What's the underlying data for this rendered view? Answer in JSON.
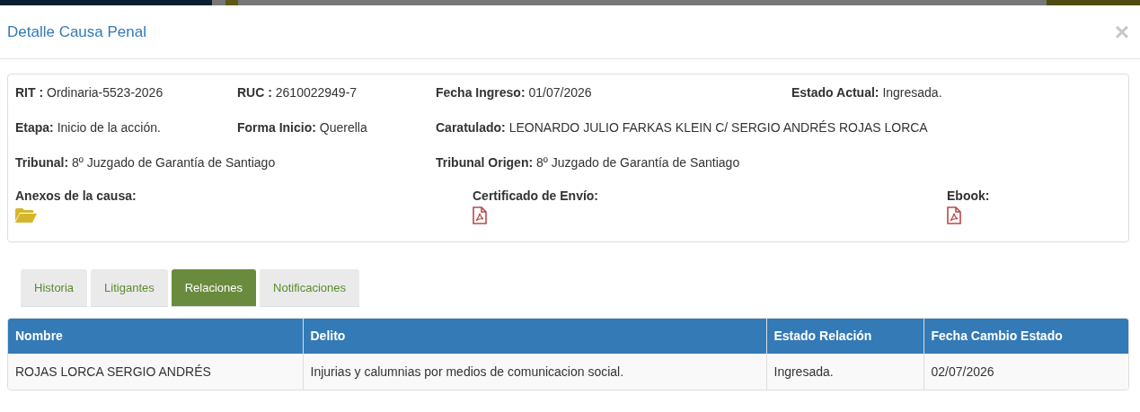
{
  "modal": {
    "title": "Detalle Causa Penal",
    "close": "×"
  },
  "fields": [
    [
      {
        "label": "RIT :",
        "value": "Ordinaria-5523-2026"
      },
      {
        "label": "RUC :",
        "value": "2610022949-7"
      },
      {
        "label": "Fecha Ingreso:",
        "value": "01/07/2026"
      },
      {
        "label": "Estado Actual:",
        "value": "Ingresada."
      }
    ],
    [
      {
        "label": "Etapa:",
        "value": "Inicio de la acción."
      },
      {
        "label": "Forma Inicio:",
        "value": "Querella"
      },
      {
        "label": "Caratulado:",
        "value": "LEONARDO JULIO FARKAS KLEIN C/ SERGIO ANDRÉS ROJAS LORCA"
      }
    ],
    [
      {
        "label": "Tribunal:",
        "value": "8º Juzgado de Garantía de Santiago"
      },
      {
        "label": "Tribunal Origen:",
        "value": "8º Juzgado de Garantía de Santiago"
      }
    ]
  ],
  "attachments": [
    {
      "label": "Anexos de la causa:",
      "kind": "folder"
    },
    {
      "label": "Certificado de Envío:",
      "kind": "pdf"
    },
    {
      "label": "Ebook:",
      "kind": "pdf"
    }
  ],
  "tabs": [
    {
      "label": "Historia",
      "selected": false
    },
    {
      "label": "Litigantes",
      "selected": false
    },
    {
      "label": "Relaciones",
      "selected": true
    },
    {
      "label": "Notificaciones",
      "selected": false
    }
  ],
  "table": {
    "columns": [
      "Nombre",
      "Delito",
      "Estado Relación",
      "Fecha Cambio Estado"
    ],
    "rows": [
      [
        "ROJAS LORCA SERGIO ANDRÉS",
        "Injurias y calumnias por medios de comunicacion social.",
        "Ingresada.",
        "02/07/2026"
      ]
    ]
  }
}
